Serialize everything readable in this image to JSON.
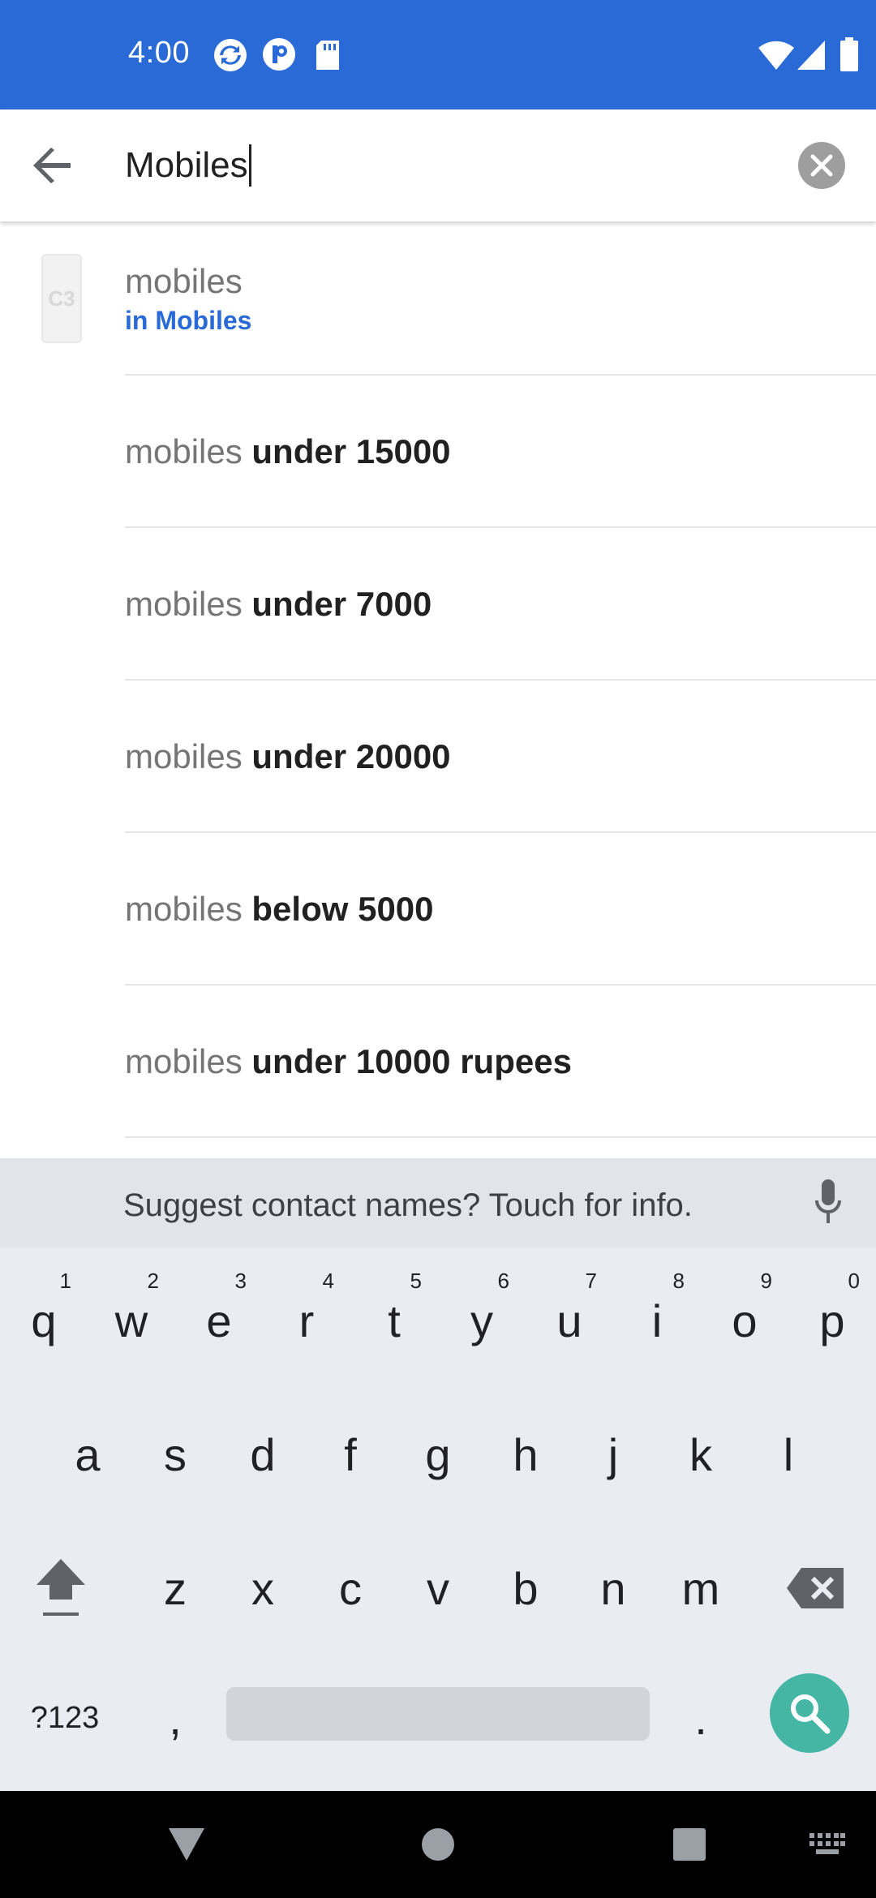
{
  "status_bar": {
    "time": "4:00",
    "icons": [
      "sync-icon",
      "notification-p-icon",
      "sd-card-icon",
      "wifi-icon",
      "signal-icon",
      "battery-icon"
    ],
    "background": "#2a6ad6"
  },
  "search": {
    "query": "Mobiles",
    "back_icon": "arrow-back-icon",
    "clear_icon": "clear-icon"
  },
  "suggestions": [
    {
      "prefix": "mobiles",
      "bold": "",
      "sub": "in Mobiles",
      "leading": "product-thumbnail",
      "thumb_text": "C3"
    },
    {
      "prefix": "mobiles",
      "bold": "under 15000",
      "sub": "",
      "leading": "search-icon-faded"
    },
    {
      "prefix": "mobiles",
      "bold": "under 7000",
      "sub": "",
      "leading": "search-icon-faded"
    },
    {
      "prefix": "mobiles",
      "bold": "under 20000",
      "sub": "",
      "leading": "search-icon"
    },
    {
      "prefix": "mobiles",
      "bold": "below 5000",
      "sub": "",
      "leading": "search-icon"
    },
    {
      "prefix": "mobiles",
      "bold": "under 10000 rupees",
      "sub": "",
      "leading": "search-icon"
    }
  ],
  "keyboard": {
    "suggestion_strip": "Suggest contact names? Touch for info.",
    "row1": [
      "q",
      "w",
      "e",
      "r",
      "t",
      "y",
      "u",
      "i",
      "o",
      "p"
    ],
    "row1_hints": [
      "1",
      "2",
      "3",
      "4",
      "5",
      "6",
      "7",
      "8",
      "9",
      "0"
    ],
    "row2": [
      "a",
      "s",
      "d",
      "f",
      "g",
      "h",
      "j",
      "k",
      "l"
    ],
    "row3": [
      "z",
      "x",
      "c",
      "v",
      "b",
      "n",
      "m"
    ],
    "symbols_key": "?123",
    "comma_key": ",",
    "period_key": ".",
    "accent_color": "#45b6a4"
  },
  "nav_bar": {
    "items": [
      "back-triangle-icon",
      "home-circle-icon",
      "recents-square-icon",
      "keyboard-switch-icon"
    ]
  }
}
